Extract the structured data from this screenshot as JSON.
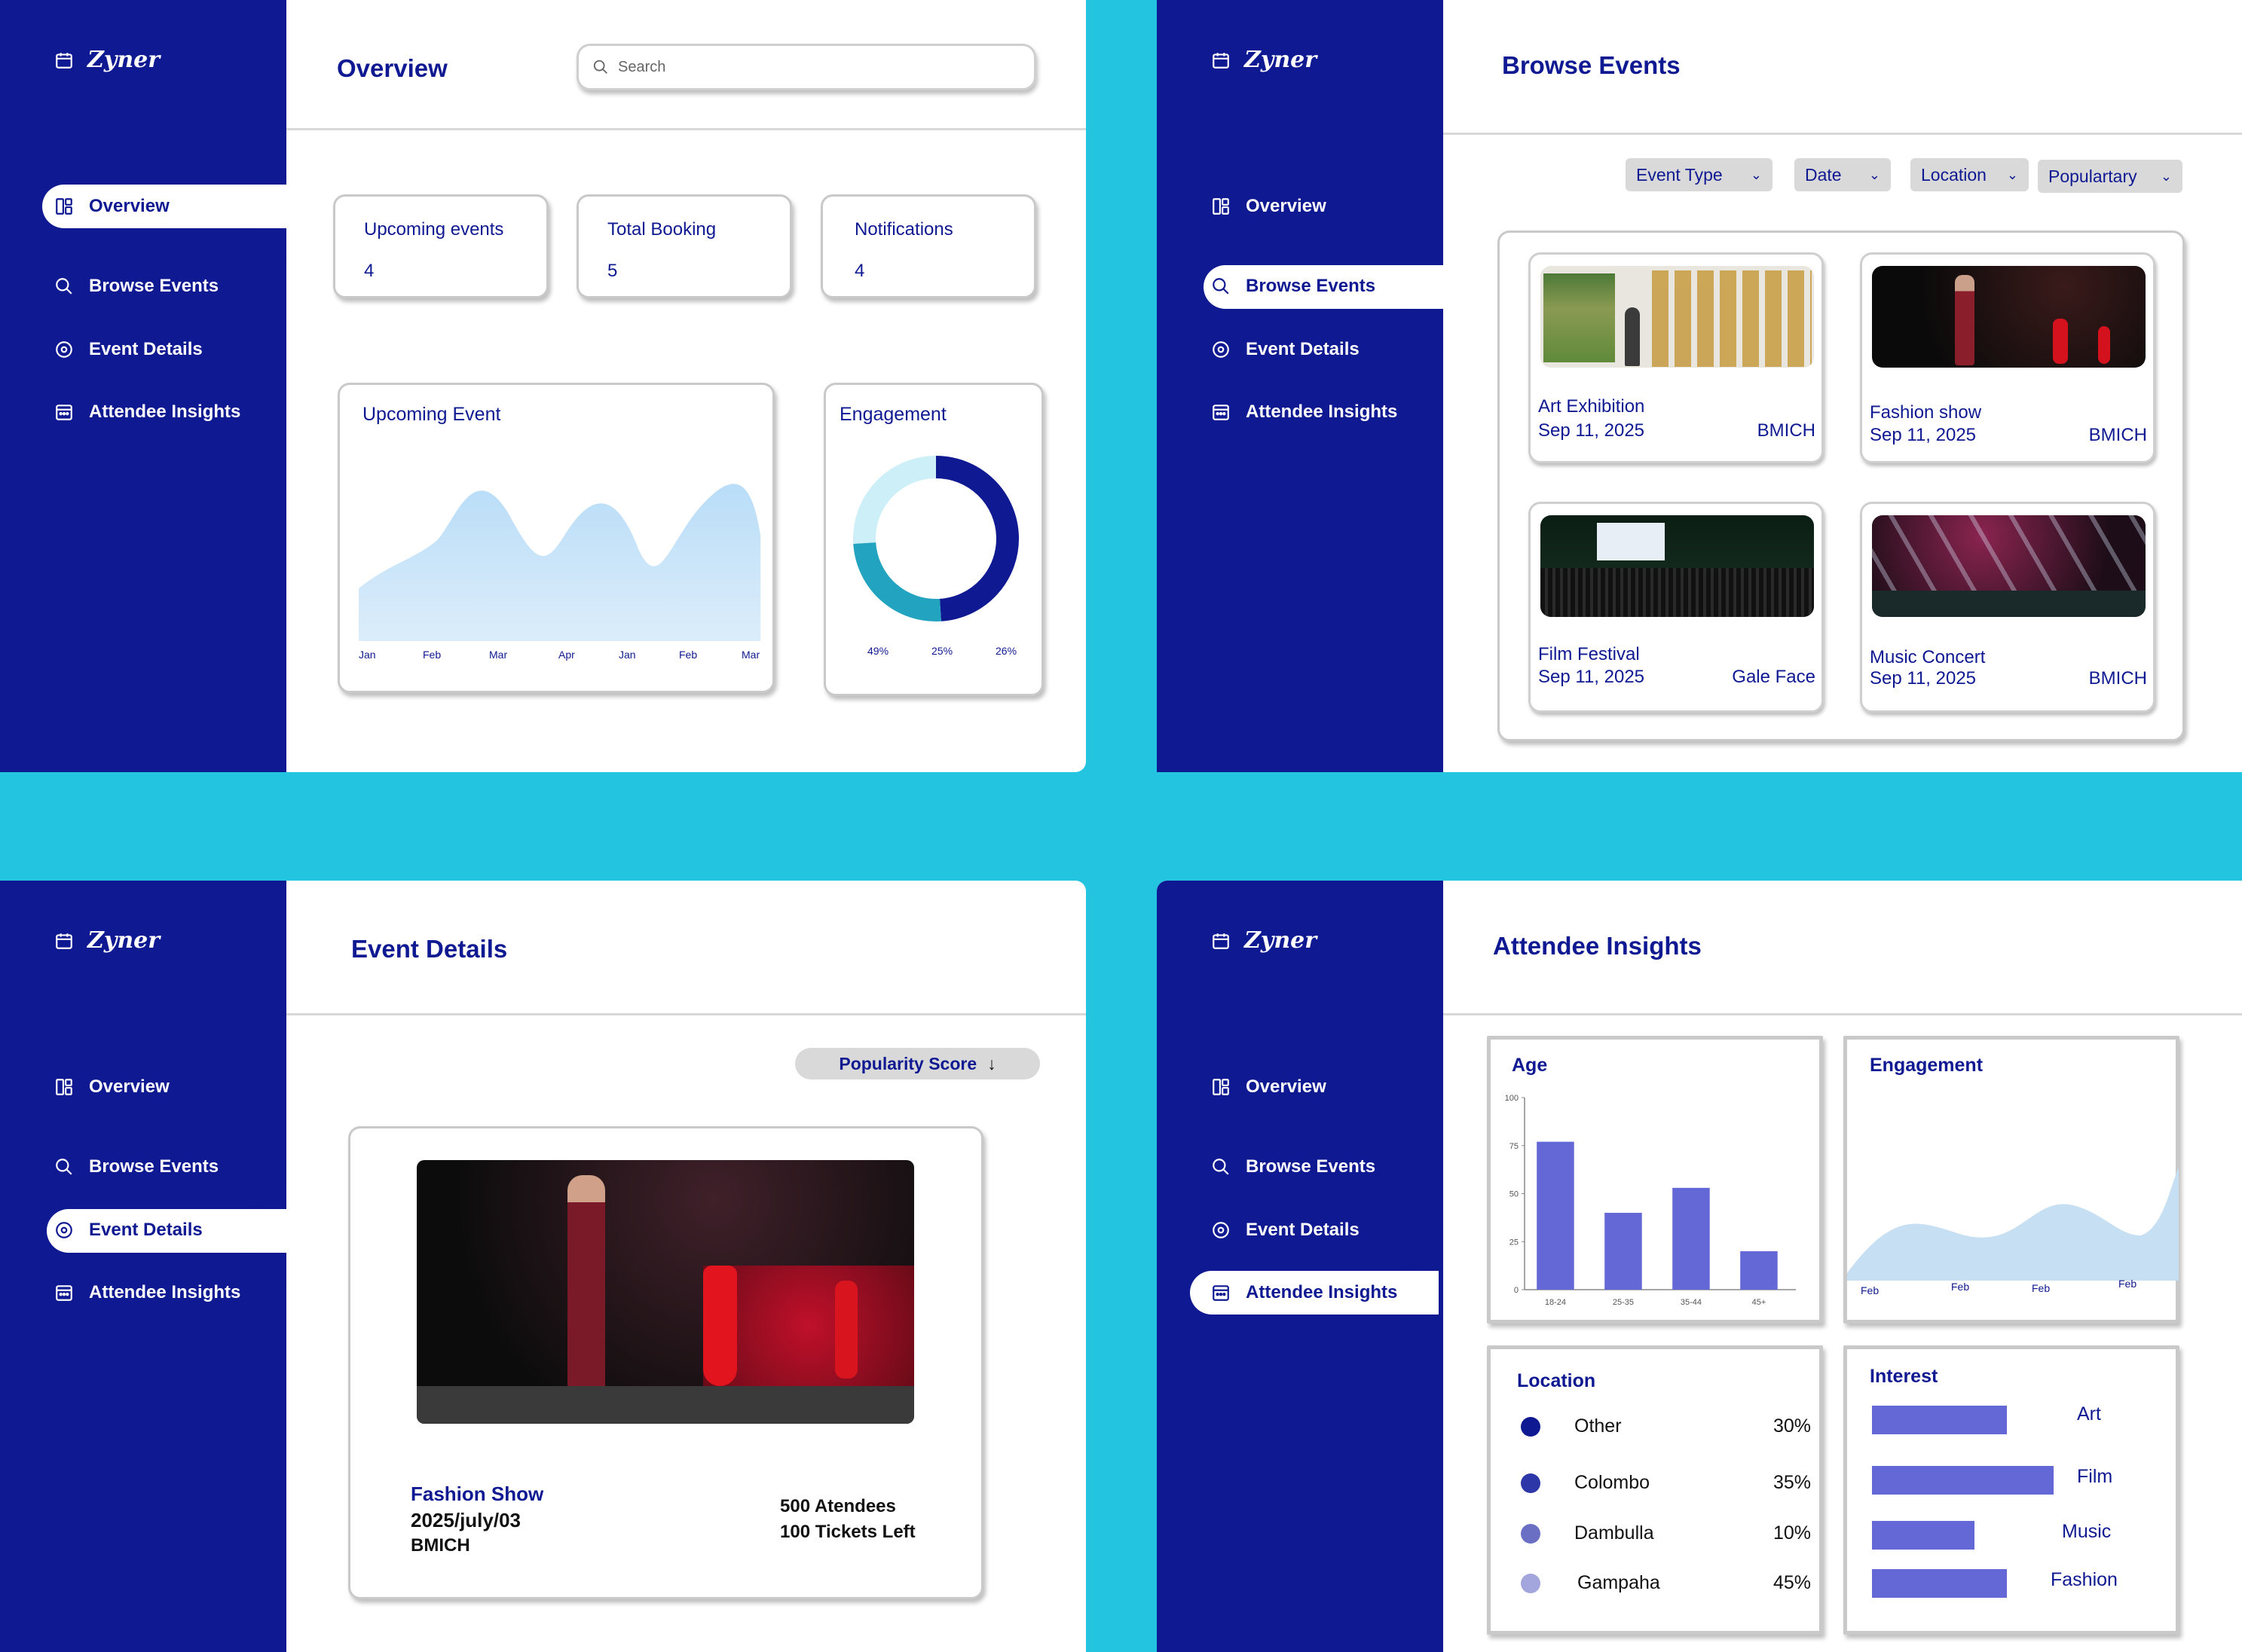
{
  "brand": "Zyner",
  "nav": [
    "Overview",
    "Browse Events",
    "Event Details",
    "Attendee Insights"
  ],
  "icons": {
    "brand": "calendar-icon",
    "overview": "dashboard-icon",
    "browse": "search-icon",
    "details": "target-icon",
    "insights": "calendar-grid-icon"
  },
  "colors": {
    "sidebar": "#0f1991",
    "accent": "#22c4df",
    "bar": "#6467d6"
  },
  "overview": {
    "title": "Overview",
    "search_placeholder": "Search",
    "stats": [
      {
        "label": "Upcoming events",
        "value": "4"
      },
      {
        "label": "Total Booking",
        "value": "5"
      },
      {
        "label": "Notifications",
        "value": "4"
      }
    ],
    "upcoming_title": "Upcoming Event",
    "upcoming_ticks": [
      "Jan",
      "Feb",
      "Mar",
      "Apr",
      "Jan",
      "Feb",
      "Mar"
    ],
    "engagement_title": "Engagement",
    "engagement_pcts": [
      "49%",
      "25%",
      "26%"
    ]
  },
  "browse": {
    "title": "Browse Events",
    "filters": [
      "Event Type",
      "Date",
      "Location",
      "Populartary"
    ],
    "events": [
      {
        "name": "Art Exhibition",
        "date": "Sep 11, 2025",
        "location": "BMICH"
      },
      {
        "name": "Fashion show",
        "date": "Sep 11, 2025",
        "location": "BMICH"
      },
      {
        "name": "Film Festival",
        "date": "Sep 11, 2025",
        "location": "Gale Face"
      },
      {
        "name": "Music Concert",
        "date": "Sep 11, 2025",
        "location": "BMICH"
      }
    ]
  },
  "details": {
    "title": "Event Details",
    "sort_label": "Popularity Score",
    "event_name": "Fashion Show",
    "event_date": "2025/july/03",
    "event_location": "BMICH",
    "attendees": "500 Atendees",
    "tickets": "100 Tickets Left"
  },
  "insights": {
    "title": "Attendee Insights",
    "age_title": "Age",
    "engagement_title": "Engagement",
    "engagement_ticks": [
      "Feb",
      "Feb",
      "Feb",
      "Feb"
    ],
    "location_title": "Location",
    "locations": [
      {
        "name": "Other",
        "pct": "30%",
        "color": "#0f1991"
      },
      {
        "name": "Colombo",
        "pct": "35%",
        "color": "#2d37a8"
      },
      {
        "name": "Dambulla",
        "pct": "10%",
        "color": "#6a6fc4"
      },
      {
        "name": "Gampaha",
        "pct": "45%",
        "color": "#a3a6dc"
      }
    ],
    "interest_title": "Interest",
    "interests": [
      {
        "name": "Art",
        "value": 0.72
      },
      {
        "name": "Film",
        "value": 0.97
      },
      {
        "name": "Music",
        "value": 0.55
      },
      {
        "name": "Fashion",
        "value": 0.72
      }
    ]
  },
  "chart_data": [
    {
      "type": "area",
      "title": "Upcoming Event",
      "x": [
        "Jan",
        "Feb",
        "Mar",
        "Apr",
        "Jan",
        "Feb",
        "Mar"
      ],
      "ylim": [
        0,
        100
      ]
    },
    {
      "type": "pie",
      "title": "Engagement",
      "values": [
        49,
        25,
        26
      ],
      "labels": [
        "49%",
        "25%",
        "26%"
      ]
    },
    {
      "type": "bar",
      "title": "Age",
      "categories": [
        "18-24",
        "25-35",
        "35-44",
        "45+"
      ],
      "values": [
        77,
        40,
        53,
        20
      ],
      "ylim": [
        0,
        100
      ],
      "yticks": [
        0,
        25,
        50,
        75,
        100
      ]
    },
    {
      "type": "area",
      "title": "Engagement",
      "x": [
        "Feb",
        "Feb",
        "Feb",
        "Feb"
      ]
    }
  ]
}
